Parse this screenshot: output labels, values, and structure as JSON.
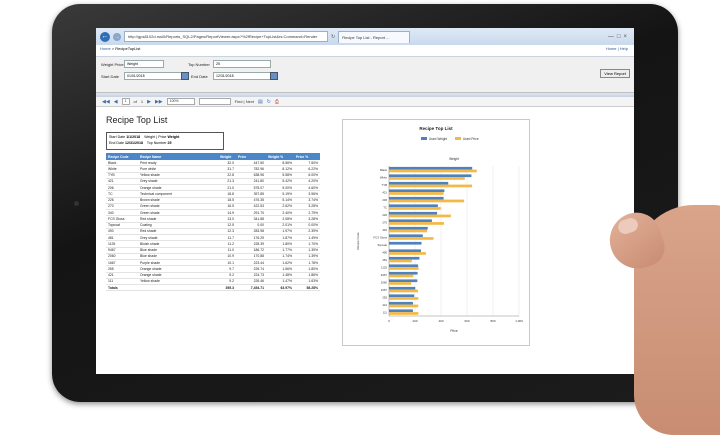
{
  "browser": {
    "url": "http://gps8102d.rssi0/Reports_SQL2/Pages/ReportViewer.aspx?%2fRecipe+TopList&rs:Command=Render",
    "tab_title": "Recipe Top List - Report ..."
  },
  "nav": {
    "home": "Home",
    "crumb": "RecipeTopList",
    "links": "Home | Help",
    "view_report": "View Report"
  },
  "params": {
    "weight_price_label": "Weight Price",
    "weight_price_value": "Weight",
    "top_number_label": "Top Number",
    "top_number_value": "25",
    "start_date_label": "Start Date",
    "start_date_value": "01/01/2018",
    "end_date_label": "End Date",
    "end_date_value": "12/31/2018"
  },
  "toolbar": {
    "page_current": "1",
    "page_total": "1",
    "zoom": "100%",
    "find_label": "Find | Next"
  },
  "report": {
    "title": "Recipe Top List",
    "info": {
      "start_label": "Start Date",
      "start_value": "1/1/2018",
      "end_label": "End Date",
      "end_value": "12/31/2018",
      "wp_label": "Weight | Price",
      "wp_value": "Weight",
      "top_label": "Top Number",
      "top_value": "25"
    },
    "columns": [
      "Recipe Code",
      "Recipe Name",
      "Weight",
      "Price",
      "Weight %",
      "Price %"
    ],
    "rows": [
      [
        "Black",
        "Print ready",
        "",
        "32.0",
        "447.50",
        "8.56%",
        "7.50%"
      ],
      [
        "White",
        "Pure white",
        "",
        "31.7",
        "782.96",
        "8.12%",
        "6.22%"
      ],
      [
        "TYB",
        "Yellow shade",
        "",
        "22.8",
        "638.96",
        "5.58%",
        "6.00%"
      ],
      [
        "421",
        "Grey shade",
        "",
        "21.3",
        "241.80",
        "5.42%",
        "4.20%"
      ],
      [
        "206",
        "Orange shade",
        "",
        "21.0",
        "578.07",
        "5.00%",
        "4.60%"
      ],
      [
        "TC",
        "Technical component",
        "",
        "18.8",
        "397.85",
        "5.19%",
        "3.96%"
      ],
      [
        "226",
        "Brown shade",
        "",
        "18.5",
        "476.35",
        "5.14%",
        "3.74%"
      ],
      [
        "270",
        "Green shade",
        "",
        "16.5",
        "422.53",
        "2.62%",
        "3.28%"
      ],
      [
        "340",
        "Green shade",
        "",
        "14.9",
        "291.70",
        "2.40%",
        "2.79%"
      ],
      [
        "FCS Gloss",
        "Red shade",
        "",
        "13.0",
        "341.88",
        "2.08%",
        "3.28%"
      ],
      [
        "Topcoat",
        "Coating",
        "",
        "12.5",
        "0.00",
        "2.01%",
        "0.00%"
      ],
      [
        "490",
        "Red shade",
        "",
        "12.3",
        "283.98",
        "1.97%",
        "2.39%"
      ],
      [
        "481",
        "Grey shade",
        "",
        "11.7",
        "176.29",
        "1.87%",
        "1.49%"
      ],
      [
        "1125",
        "Bluish shade",
        "",
        "11.2",
        "228.39",
        "1.80%",
        "1.70%"
      ],
      [
        "9467",
        "Blue shade",
        "",
        "11.0",
        "186.72",
        "1.77%",
        "1.39%"
      ],
      [
        "2060",
        "Blue shade",
        "",
        "10.9",
        "170.88",
        "1.74%",
        "1.39%"
      ],
      [
        "1667",
        "Purple shade",
        "",
        "10.1",
        "223.44",
        "1.62%",
        "1.78%"
      ],
      [
        "255",
        "Orange shade",
        "",
        "9.7",
        "225.74",
        "1.56%",
        "1.80%"
      ],
      [
        "421",
        "Orange shade",
        "",
        "9.2",
        "224.73",
        "1.48%",
        "1.86%"
      ],
      [
        "111",
        "Yellow shade",
        "",
        "9.2",
        "226.46",
        "1.47%",
        "1.63%"
      ]
    ],
    "totals": [
      "Totals",
      "",
      "",
      "395.3",
      "7,454.71",
      "63.97%",
      "58.28%"
    ]
  },
  "chart_data": {
    "type": "bar",
    "orientation": "horizontal",
    "title": "Recipe Top List",
    "xlabel": "Price",
    "ylabel": "Recipe Code",
    "top_axis_label": "Weight",
    "xlim": [
      0,
      1000
    ],
    "xticks": [
      0,
      200,
      400,
      600,
      800,
      1000
    ],
    "xtick_labels": [
      "0",
      "200",
      "400",
      "600",
      "800",
      "1,000"
    ],
    "legend_position": "top",
    "categories": [
      "Black",
      "White",
      "TYB",
      "421",
      "206",
      "TC",
      "226",
      "270",
      "340",
      "FCS Gloss",
      "Topcoat",
      "490",
      "481",
      "1125",
      "9467",
      "2060",
      "1667",
      "255",
      "421",
      "111"
    ],
    "series": [
      {
        "name": "Used Weight",
        "color": "#4f81bd",
        "values": [
          640,
          634,
          456,
          426,
          420,
          376,
          370,
          330,
          298,
          260,
          250,
          246,
          234,
          224,
          220,
          218,
          202,
          194,
          184,
          184
        ]
      },
      {
        "name": "Used Price",
        "color": "#f4b942",
        "values": [
          675,
          583,
          639,
          420,
          578,
          398,
          476,
          423,
          292,
          342,
          0,
          284,
          176,
          228,
          187,
          171,
          223,
          226,
          225,
          226
        ]
      }
    ],
    "grid": true,
    "colors": {
      "header": "#4a86c8"
    }
  }
}
